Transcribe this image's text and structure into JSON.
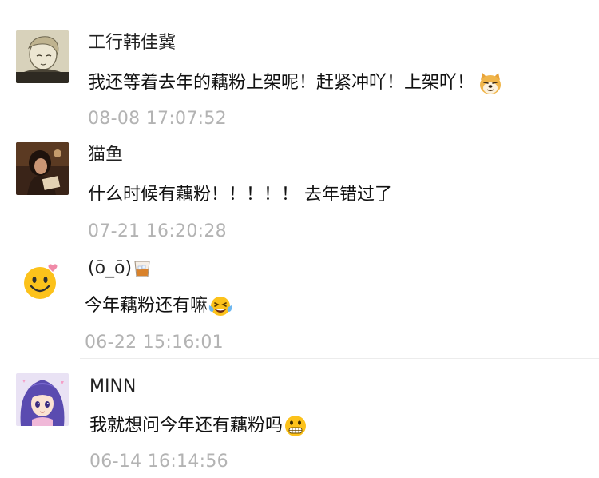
{
  "comments": [
    {
      "username": "工行韩佳冀",
      "text": "我还等着去年的藕粉上架呢！赶紧冲吖！上架吖！",
      "time": "08-08 17:07:52",
      "emoji": "doge-emoji"
    },
    {
      "username": "猫鱼",
      "text": "什么时候有藕粉！！！！！ 去年错过了",
      "time": "07-21 16:20:28",
      "emoji": ""
    },
    {
      "username": "(ō_ō)",
      "username_emoji": "whisky-glass-icon",
      "text": "今年藕粉还有嘛",
      "time": "06-22 15:16:01",
      "emoji": "laugh-cry-emoji"
    },
    {
      "username": "MINN",
      "text": "我就想问今年还有藕粉吗",
      "time": "06-14 16:14:56",
      "emoji": "grimace-emoji"
    }
  ],
  "colors": {
    "username": "#222222",
    "text": "#111111",
    "timestamp": "#b3b3b3",
    "emoji_yellow": "#fcc21b"
  }
}
